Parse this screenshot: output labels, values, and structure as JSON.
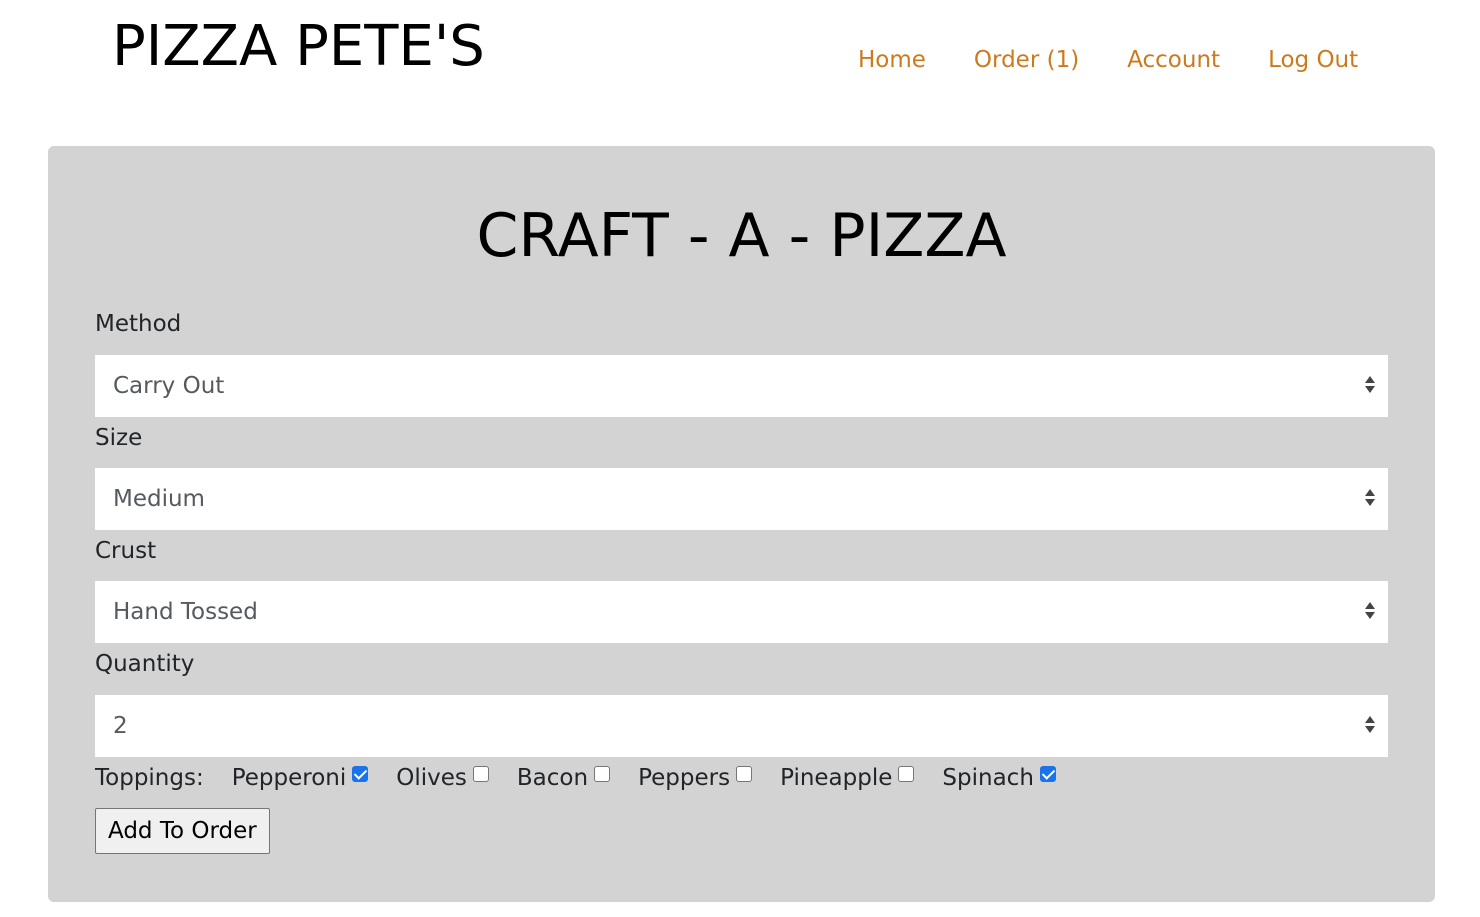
{
  "header": {
    "brand": "PIZZA PETE'S",
    "nav": [
      {
        "label": "Home"
      },
      {
        "label": "Order (1)"
      },
      {
        "label": "Account"
      },
      {
        "label": "Log Out"
      }
    ],
    "link_color": "#cc7a1e"
  },
  "form": {
    "title": "CRAFT - A - PIZZA",
    "panel_color": "#d3d3d3",
    "method": {
      "label": "Method",
      "value": "Carry Out"
    },
    "size": {
      "label": "Size",
      "value": "Medium"
    },
    "crust": {
      "label": "Crust",
      "value": "Hand Tossed"
    },
    "quantity": {
      "label": "Quantity",
      "value": "2"
    },
    "toppings_label": "Toppings:",
    "toppings": [
      {
        "name": "Pepperoni",
        "checked": true
      },
      {
        "name": "Olives",
        "checked": false
      },
      {
        "name": "Bacon",
        "checked": false
      },
      {
        "name": "Peppers",
        "checked": false
      },
      {
        "name": "Pineapple",
        "checked": false
      },
      {
        "name": "Spinach",
        "checked": true
      }
    ],
    "submit_label": "Add To Order"
  }
}
